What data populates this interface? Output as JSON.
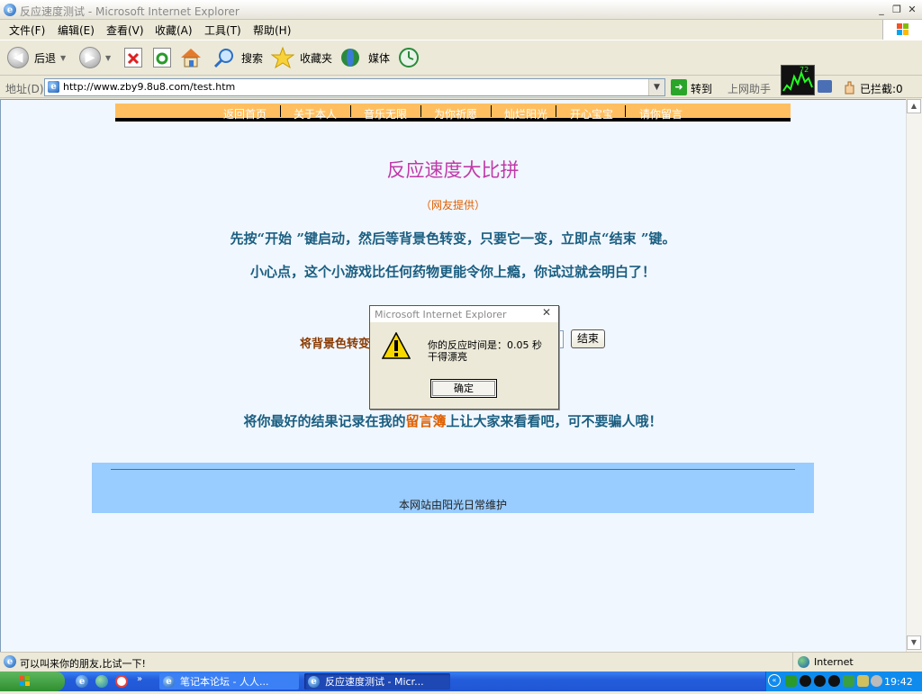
{
  "window": {
    "title": "反应速度测试 - Microsoft Internet Explorer"
  },
  "menu": [
    "文件(F)",
    "编辑(E)",
    "查看(V)",
    "收藏(A)",
    "工具(T)",
    "帮助(H)"
  ],
  "toolbar": {
    "back": "后退",
    "search": "搜索",
    "favorites": "收藏夹",
    "media": "媒体"
  },
  "address": {
    "label": "地址(D)",
    "url": "http://www.zby9.8u8.com/test.htm",
    "go": "转到",
    "helper": "上网助手",
    "blocked": "已拦截:0",
    "meter": "72"
  },
  "page": {
    "nav": [
      "返回首页",
      "关于本人",
      "音乐无限",
      "为你祈愿",
      "灿烂阳光",
      "开心宝宝",
      "请你留言"
    ],
    "title": "反应速度大比拼",
    "credit": "（网友提供）",
    "instruction1": "先按“开始 ”键启动，然后等背景色转变，只要它一变，立即点“结束 ”键。",
    "instruction2": "小心点，这个小游戏比任何药物更能令你上瘾，你试过就会明白了！",
    "bg_label": "将背景色转变",
    "end_button": "结束",
    "record_prefix": "将你最好的结果记录在我的",
    "record_link": "留言簿",
    "record_suffix": "上让大家来看看吧，可不要骗人哦！",
    "footer": "本网站由阳光日常维护"
  },
  "dialog": {
    "title": "Microsoft Internet Explorer",
    "line1": "你的反应时间是：0.05 秒",
    "line2": "干得漂亮",
    "ok": "确定"
  },
  "status": {
    "text": "可以叫来你的朋友,比试一下!",
    "zone": "Internet"
  },
  "taskbar": {
    "task1": "笔记本论坛 - 人人...",
    "task2": "反应速度测试 - Micr...",
    "clock": "19:42"
  },
  "colors": {
    "nav_bg": "#ffbf60",
    "title": "#c03aa8",
    "text": "#1a5e80",
    "footer_bg": "#99ccff"
  }
}
